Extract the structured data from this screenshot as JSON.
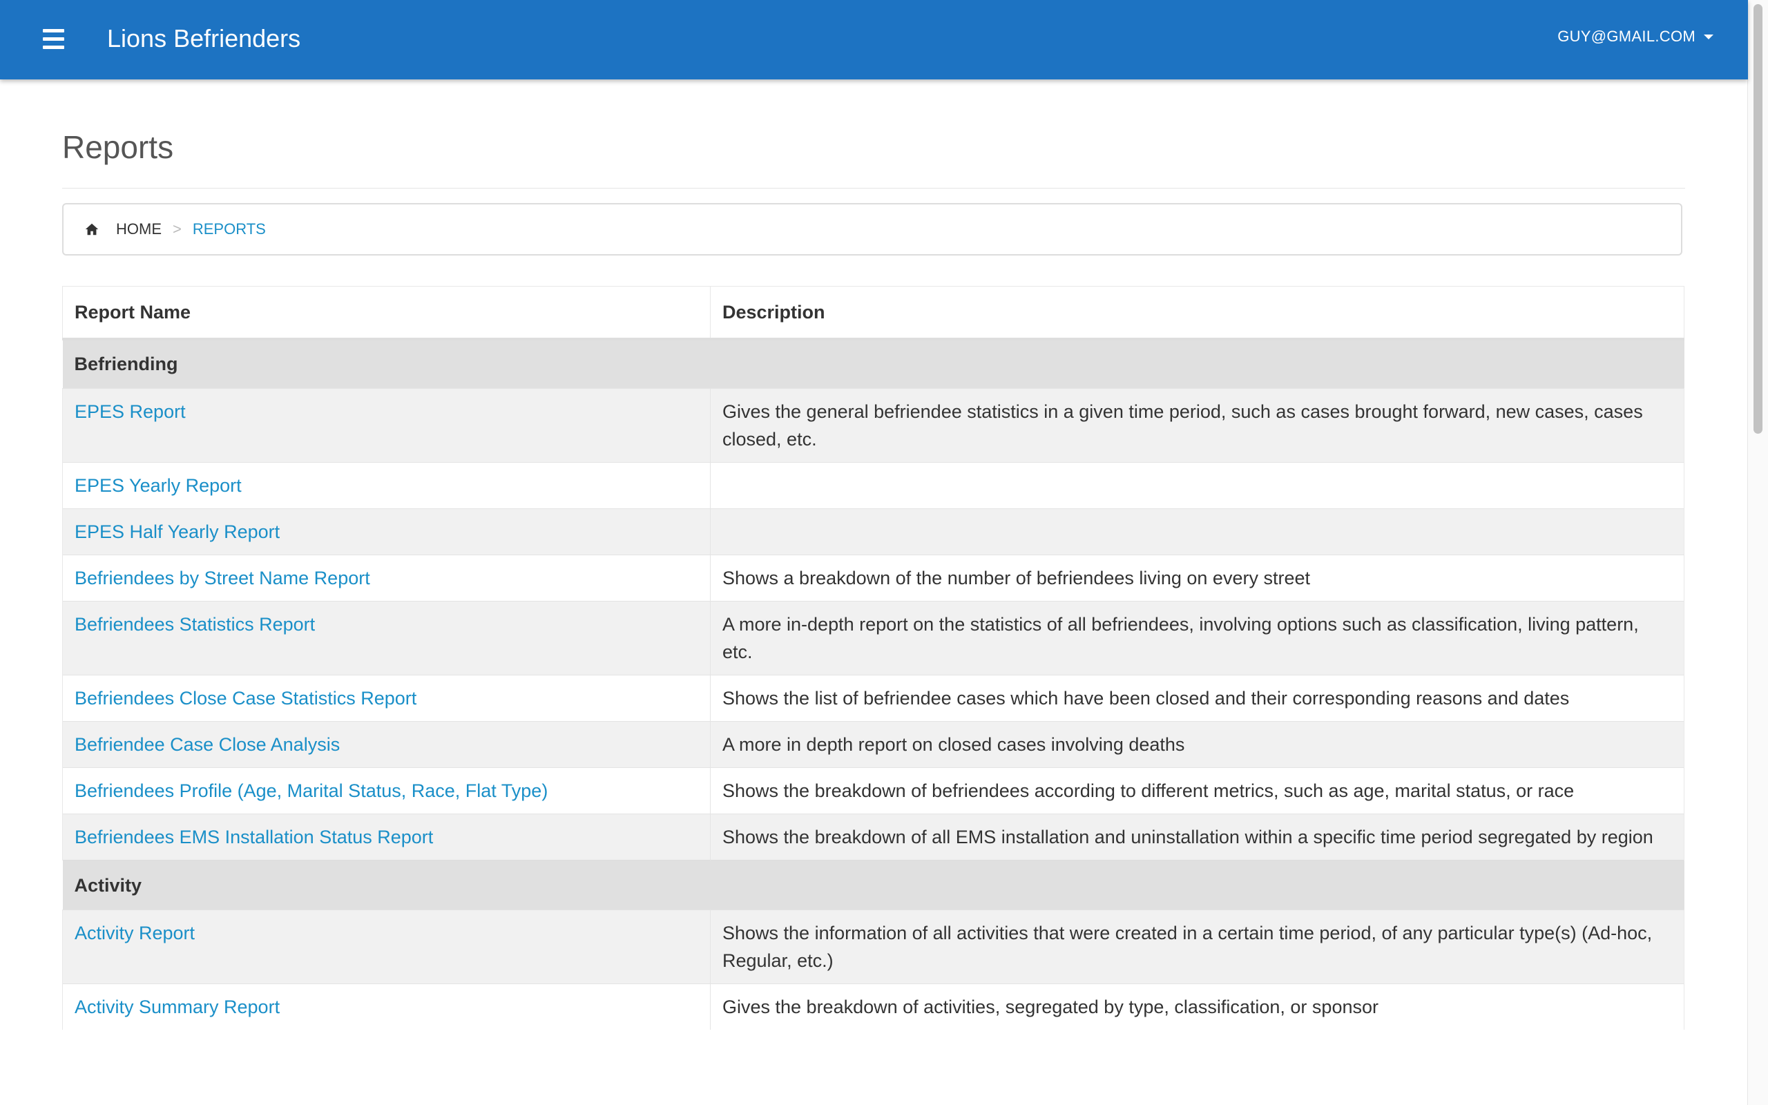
{
  "header": {
    "brand": "Lions Befrienders",
    "user_email": "GUY@GMAIL.COM"
  },
  "page": {
    "title": "Reports"
  },
  "breadcrumb": {
    "home": "HOME",
    "separator": ">",
    "current": "REPORTS"
  },
  "table": {
    "columns": [
      "Report Name",
      "Description"
    ],
    "groups": [
      {
        "name": "Befriending",
        "rows": [
          {
            "name": "EPES Report",
            "description": "Gives the general befriendee statistics in a given time period, such as cases brought forward, new cases, cases closed, etc."
          },
          {
            "name": "EPES Yearly Report",
            "description": ""
          },
          {
            "name": "EPES Half Yearly Report",
            "description": ""
          },
          {
            "name": "Befriendees by Street Name Report",
            "description": "Shows a breakdown of the number of befriendees living on every street"
          },
          {
            "name": "Befriendees Statistics Report",
            "description": "A more in-depth report on the statistics of all befriendees, involving options such as classification, living pattern, etc."
          },
          {
            "name": "Befriendees Close Case Statistics Report",
            "description": "Shows the list of befriendee cases which have been closed and their corresponding reasons and dates"
          },
          {
            "name": "Befriendee Case Close Analysis",
            "description": "A more in depth report on closed cases involving deaths"
          },
          {
            "name": "Befriendees Profile (Age, Marital Status, Race, Flat Type)",
            "description": "Shows the breakdown of befriendees according to different metrics, such as age, marital status, or race"
          },
          {
            "name": "Befriendees EMS Installation Status Report",
            "description": "Shows the breakdown of all EMS installation and uninstallation within a specific time period segregated by region"
          }
        ]
      },
      {
        "name": "Activity",
        "rows": [
          {
            "name": "Activity Report",
            "description": "Shows the information of all activities that were created in a certain time period, of any particular type(s) (Ad-hoc, Regular, etc.)"
          },
          {
            "name": "Activity Summary Report",
            "description": "Gives the breakdown of activities, segregated by type, classification, or sponsor"
          }
        ]
      }
    ]
  },
  "colors": {
    "navbar": "#1d73c2",
    "link": "#1a8fc8",
    "group_row": "#e0e0e0",
    "striped_row": "#f1f1f1"
  }
}
